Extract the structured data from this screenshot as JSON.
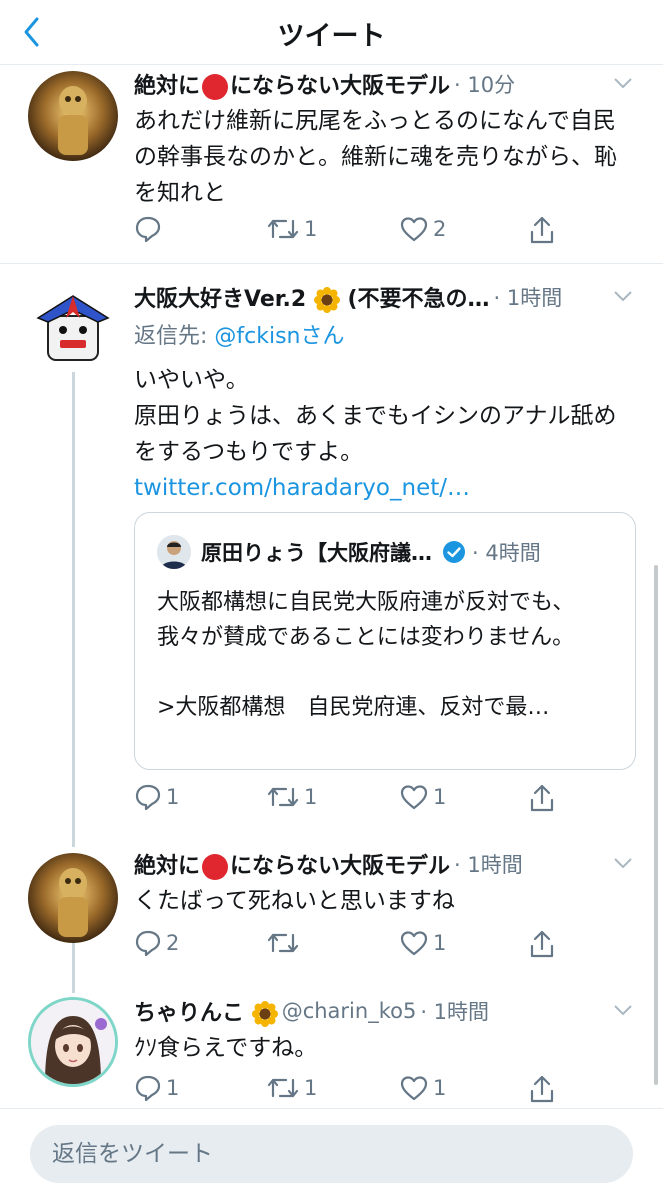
{
  "nav": {
    "title": "ツイート"
  },
  "tweets": [
    {
      "name_before": "絶対に",
      "name_after": "にならない大阪モデル",
      "time": "· 10分",
      "text": "あれだけ維新に尻尾をふっとるのになんで自民の幹事長なのかと。維新に魂を売りながら、恥を知れと",
      "reply_count": "",
      "retweet_count": "1",
      "like_count": "2"
    },
    {
      "name": "大阪大好きVer.2",
      "name_suffix": "(不要不急の…",
      "time": "· 1時間",
      "reply_to_label": "返信先: ",
      "reply_to_handle": "@fckisnさん",
      "text_line1": "いやいや。",
      "text_line2": "原田りょうは、あくまでもイシンのアナル舐めをするつもりですよ。",
      "link": "twitter.com/haradaryo_net/…",
      "quote": {
        "name": "原田りょう【大阪府議…",
        "time": "· 4時間",
        "text1": "大阪都構想に自民党大阪府連が反対でも、我々が賛成であることには変わりません。",
        "text2": ">大阪都構想　自民党府連、反対で最…"
      },
      "reply_count": "1",
      "retweet_count": "1",
      "like_count": "1"
    },
    {
      "name_before": "絶対に",
      "name_after": "にならない大阪モデル",
      "time": "· 1時間",
      "text": "くたばって死ねいと思いますね",
      "reply_count": "2",
      "retweet_count": "",
      "like_count": "1"
    },
    {
      "name": "ちゃりんこ",
      "handle": "@charin_ko5",
      "time": "· 1時間",
      "text": "ｸｿ食らえですね。",
      "reply_count": "1",
      "retweet_count": "1",
      "like_count": "1"
    }
  ],
  "composer": {
    "placeholder": "返信をツイート"
  },
  "colors": {
    "accent": "#1b95e0",
    "muted": "#657786",
    "border": "#e6ecf0"
  },
  "icons": [
    "back-chevron-icon",
    "chevron-down-icon",
    "reply-icon",
    "retweet-icon",
    "like-icon",
    "share-icon",
    "verified-badge-icon",
    "sunflower-emoji-icon",
    "red-circle-emoji-icon"
  ]
}
